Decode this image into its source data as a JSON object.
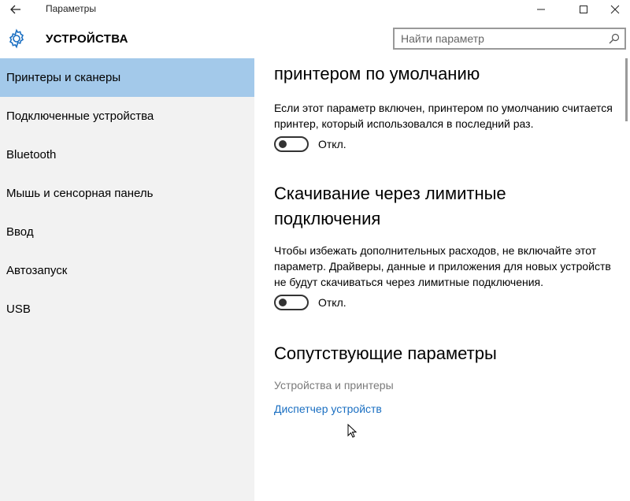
{
  "window": {
    "app_title": "Параметры",
    "back_icon": "arrow-left-icon",
    "minimize_icon": "minimize-icon",
    "maximize_icon": "maximize-icon",
    "close_icon": "close-icon"
  },
  "header": {
    "icon": "gear-icon",
    "title": "УСТРОЙСТВА",
    "search": {
      "placeholder": "Найти параметр",
      "value": "",
      "icon": "search-icon"
    }
  },
  "sidebar": {
    "items": [
      {
        "label": "Принтеры и сканеры",
        "active": true
      },
      {
        "label": "Подключенные устройства",
        "active": false
      },
      {
        "label": "Bluetooth",
        "active": false
      },
      {
        "label": "Мышь и сенсорная панель",
        "active": false
      },
      {
        "label": "Ввод",
        "active": false
      },
      {
        "label": "Автозапуск",
        "active": false
      },
      {
        "label": "USB",
        "active": false
      }
    ]
  },
  "content": {
    "default_printer": {
      "heading_partial": "принтером по умолчанию",
      "description": "Если этот параметр включен, принтером по умолчанию считается принтер, который использовался в последний раз.",
      "toggle_state": "off",
      "toggle_label": "Откл."
    },
    "metered_download": {
      "heading": "Скачивание через лимитные подключения",
      "description": "Чтобы избежать дополнительных расходов, не включайте этот параметр. Драйверы, данные и приложения для новых устройств не будут скачиваться через лимитные подключения.",
      "toggle_state": "off",
      "toggle_label": "Откл."
    },
    "related": {
      "heading": "Сопутствующие параметры",
      "links": [
        {
          "label": "Устройства и принтеры",
          "state": "disabled"
        },
        {
          "label": "Диспетчер устройств",
          "state": "enabled"
        }
      ]
    }
  },
  "colors": {
    "active_nav": "#a3c9ea",
    "sidebar_bg": "#f2f2f2",
    "link": "#1a6fc2",
    "disabled_link": "#7a7a7a"
  }
}
